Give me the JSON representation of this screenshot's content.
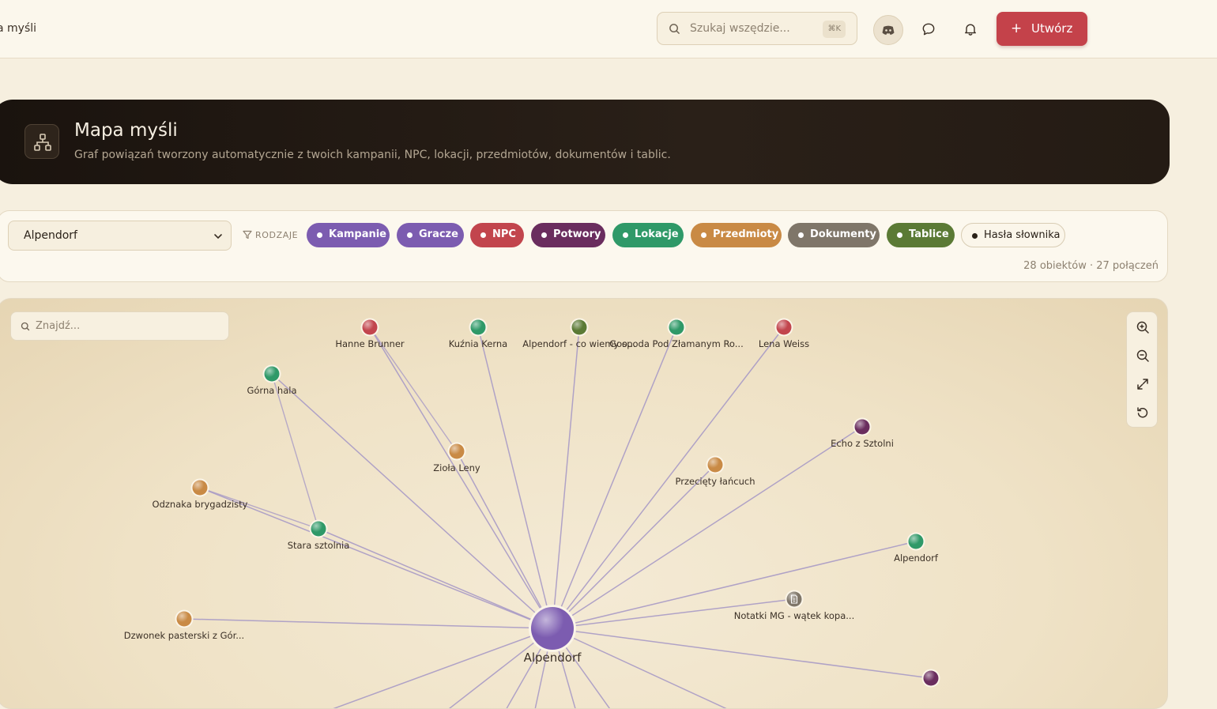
{
  "header": {
    "breadcrumb": "a myśli",
    "search": {
      "placeholder": "Szukaj wszędzie...",
      "shortcut": "⌘K"
    },
    "discord_icon": "discord-icon",
    "chat_icon": "chat-bubble-icon",
    "bell_icon": "bell-icon",
    "create_label": "Utwórz",
    "accent": "#c4424a"
  },
  "hero": {
    "title": "Mapa myśli",
    "subtitle": "Graf powiązań tworzony automatycznie z twoich kampanii, NPC, lokacji, przedmiotów, dokumentów i tablic.",
    "icon": "hierarchy-icon"
  },
  "filters": {
    "selected_campaign": "Alpendorf",
    "kinds_label": "RODZAJE",
    "chips": [
      {
        "label": "Kampanie",
        "color": "#7c5cb0",
        "active": true
      },
      {
        "label": "Gracze",
        "color": "#7c5cb0",
        "active": true
      },
      {
        "label": "NPC",
        "color": "#c2454d",
        "active": true
      },
      {
        "label": "Potwory",
        "color": "#6a2d5e",
        "active": true
      },
      {
        "label": "Lokacje",
        "color": "#2f9968",
        "active": true
      },
      {
        "label": "Przedmioty",
        "color": "#c98a45",
        "active": true
      },
      {
        "label": "Dokumenty",
        "color": "#7f7669",
        "active": true
      },
      {
        "label": "Tablice",
        "color": "#5b7a35",
        "active": true
      },
      {
        "label": "Hasła słownika",
        "color": "#2a2118",
        "active": false
      }
    ],
    "counts": "28 obiektów · 27 połączeń"
  },
  "graph": {
    "find_placeholder": "Znajdź...",
    "controls": [
      "zoom-in-icon",
      "zoom-out-icon",
      "fullscreen-icon",
      "reset-icon"
    ],
    "edge_color": "#a99bc6",
    "center": {
      "label": "Alpendorf",
      "color": "#7c5cb0"
    },
    "nodes": [
      {
        "label": "Hanne Brunner",
        "kind": "NPC",
        "color": "#c2454d"
      },
      {
        "label": "Kuźnia Kerna",
        "kind": "Lokacje",
        "color": "#2f9968"
      },
      {
        "label": "Alpendorf - co wiemy o...",
        "kind": "Tablice",
        "color": "#5b7a35"
      },
      {
        "label": "Gospoda Pod Złamanym Ro...",
        "kind": "Lokacje",
        "color": "#2f9968"
      },
      {
        "label": "Lena Weiss",
        "kind": "NPC",
        "color": "#c2454d"
      },
      {
        "label": "Górna hala",
        "kind": "Lokacje",
        "color": "#2f9968"
      },
      {
        "label": "Echo z Sztolni",
        "kind": "Potwory",
        "color": "#6a2d5e"
      },
      {
        "label": "Zioła Leny",
        "kind": "Przedmioty",
        "color": "#c98a45"
      },
      {
        "label": "Przecięty łańcuch",
        "kind": "Przedmioty",
        "color": "#c98a45"
      },
      {
        "label": "Odznaka brygadzisty",
        "kind": "Przedmioty",
        "color": "#c98a45"
      },
      {
        "label": "Stara sztolnia",
        "kind": "Lokacje",
        "color": "#2f9968"
      },
      {
        "label": "Alpendorf",
        "kind": "Lokacje",
        "color": "#2f9968"
      },
      {
        "label": "Notatki MG - wątek kopa...",
        "kind": "Dokumenty",
        "color": "#7f7669"
      },
      {
        "label": "Dzwonek pasterski z Gór...",
        "kind": "Przedmioty",
        "color": "#c98a45"
      },
      {
        "label": "",
        "kind": "Potwory",
        "color": "#6a2d5e"
      }
    ]
  }
}
